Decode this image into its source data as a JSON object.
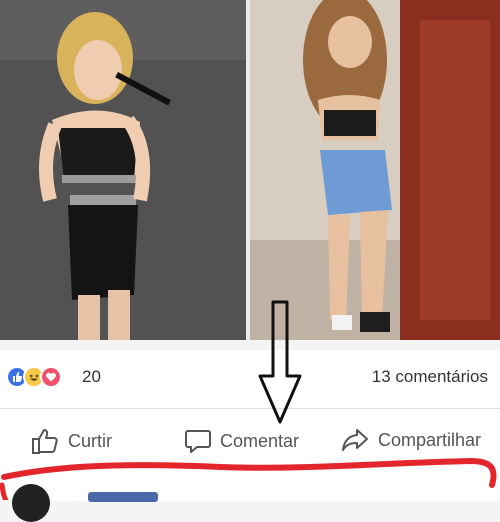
{
  "post": {
    "reactions": {
      "icons": [
        "like-icon",
        "haha-icon",
        "love-icon"
      ],
      "count": "20",
      "comments": "13 comentários"
    },
    "actions": {
      "like": "Curtir",
      "comment": "Comentar",
      "share": "Compartilhar"
    }
  },
  "colors": {
    "like_blue": "#3b6fe8",
    "haha_yellow": "#f7c948",
    "love_red": "#f0506e",
    "annotation_red": "#e3262b"
  }
}
